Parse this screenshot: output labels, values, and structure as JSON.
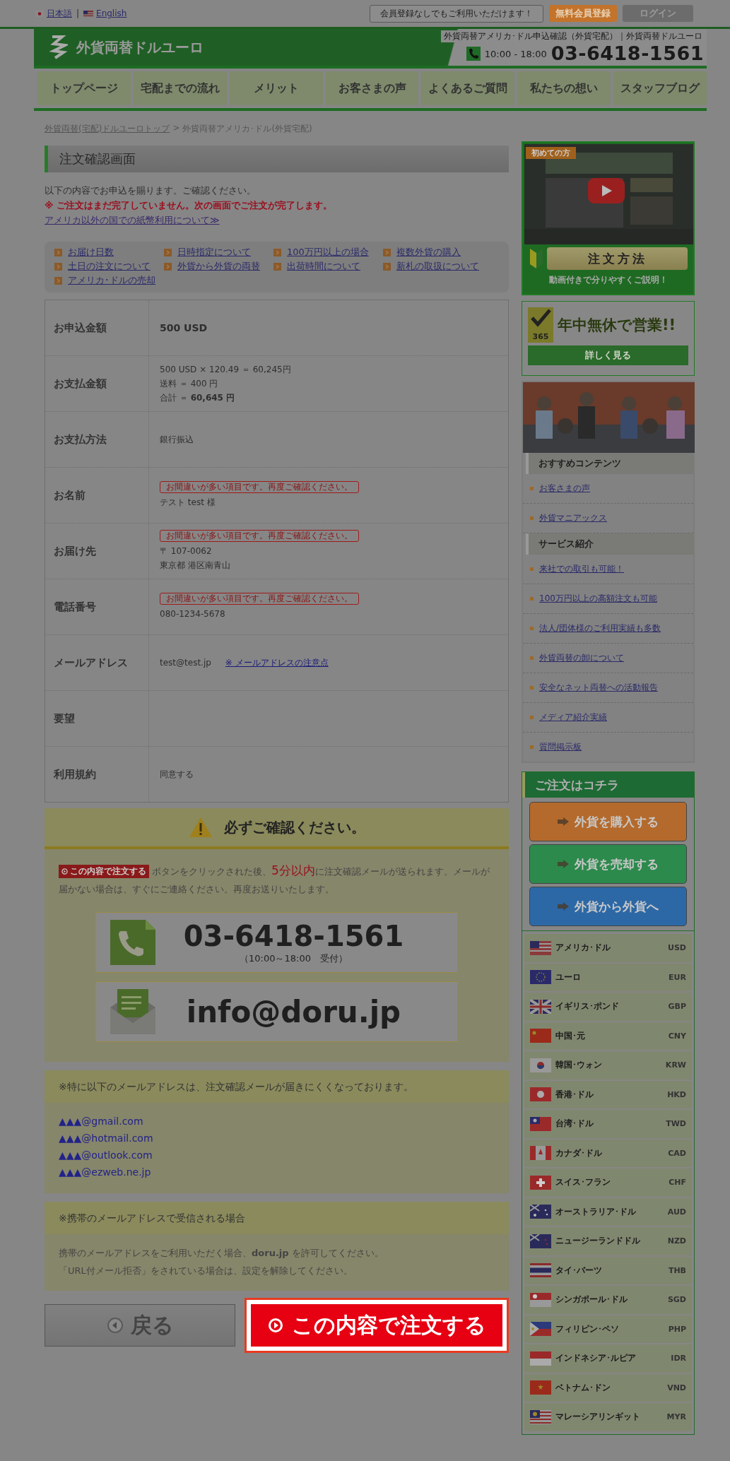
{
  "top_bar": {
    "languages": [
      "日本語",
      "English"
    ],
    "separator": "|",
    "notice": "会員登録なしでもご利用いただけます！",
    "register_button": "無料会員登録",
    "login_button": "ログイン"
  },
  "header": {
    "site_name": "外貨両替ドルユーロ",
    "tagline": "外貨両替アメリカ･ドル申込確認（外貨宅配）｜外貨両替ドルユーロ",
    "hours": "10:00 - 18:00",
    "phone": "03-6418-1561"
  },
  "nav": [
    "トップページ",
    "宅配までの流れ",
    "メリット",
    "お客さまの声",
    "よくあるご質問",
    "私たちの想い",
    "スタッフブログ"
  ],
  "breadcrumb": {
    "link": "外貨両替(宅配)ドルユーロトップ",
    "separator": ">",
    "current": "外貨両替アメリカ･ドル(外貨宅配)"
  },
  "page_title": "注文確認画面",
  "intro": {
    "text": "以下の内容でお申込を賜ります。ご確認ください。",
    "warning": "※ ご注文はまだ完了していません。次の画面でご注文が完了します。",
    "link": "アメリカ以外の国での紙幣利用について≫"
  },
  "faq_links": [
    "お届け日数",
    "日時指定について",
    "100万円以上の場合",
    "複数外貨の購入",
    "土日の注文について",
    "外貨から外貨の両替",
    "出荷時間について",
    "新札の取扱について",
    "アメリカ･ドルの売却"
  ],
  "order_table": [
    {
      "label": "お申込金額",
      "kind": "amount",
      "lines": [
        "500 USD"
      ]
    },
    {
      "label": "お支払金額",
      "kind": "plain",
      "lines": [
        "500 USD × 120.49 ＝ 60,245円",
        "送料 ＝ 400 円",
        "合計 ＝ **60,645 円**"
      ]
    },
    {
      "label": "お支払方法",
      "kind": "plain",
      "lines": [
        "銀行振込"
      ]
    },
    {
      "label": "お名前",
      "kind": "plain",
      "warning": "お間違いが多い項目です。再度ご確認ください。",
      "lines": [
        "テスト test 様"
      ]
    },
    {
      "label": "お届け先",
      "kind": "plain",
      "warning": "お間違いが多い項目です。再度ご確認ください。",
      "lines": [
        "〒 107-0062",
        "東京都 港区南青山"
      ]
    },
    {
      "label": "電話番号",
      "kind": "plain",
      "warning": "お間違いが多い項目です。再度ご確認ください。",
      "lines": [
        "080-1234-5678"
      ]
    },
    {
      "label": "メールアドレス",
      "kind": "plain",
      "lines": [
        "test@test.jp"
      ],
      "link": "※ メールアドレスの注意点"
    },
    {
      "label": "要望",
      "kind": "plain"
    },
    {
      "label": "利用規約",
      "kind": "plain",
      "lines": [
        "同意する"
      ]
    }
  ],
  "notice": {
    "heading": "必ずご確認ください。",
    "badge": "この内容で注文する",
    "text_before": "ボタンをクリックされた後、",
    "highlight": "5分以内",
    "text_after": "に注文確認メールが送られます。メールが届かない場合は、すぐにご連絡ください。再度お送りいたします。",
    "phone": "03-6418-1561",
    "phone_hours": "（10:00～18:00　受付）",
    "email": "info@doru.jp"
  },
  "hard_domains": {
    "heading": "※特に以下のメールアドレスは、注文確認メールが届きにくくなっております。",
    "addresses": [
      "▲▲▲@gmail.com",
      "▲▲▲@hotmail.com",
      "▲▲▲@outlook.com",
      "▲▲▲@ezweb.ne.jp"
    ]
  },
  "mobile": {
    "heading": "※携帯のメールアドレスで受信される場合",
    "lines": [
      "携帯のメールアドレスをご利用いただく場合、**doru.jp** を許可してください。",
      "「URL付メール拒否」をされている場合は、設定を解除してください。"
    ]
  },
  "actions": {
    "back": "戻る",
    "submit": "この内容で注文する"
  },
  "sidebar": {
    "video_banner": {
      "ribbon": "初めての方",
      "button": "注文方法",
      "caption": "動画付きで分りやすくご説明！"
    },
    "open_banner": {
      "badge": "365",
      "headline": "**年中無休**で営業!!",
      "button": "詳しく見る"
    },
    "sections": [
      {
        "heading": "おすすめコンテンツ",
        "items": [
          "お客さまの声",
          "外貨マニアックス"
        ]
      },
      {
        "heading": "サービス紹介",
        "items": [
          "来社での取引も可能！",
          "100万円以上の高額注文も可能",
          "法人/団体様のご利用実績も多数",
          "外貨両替の卸について",
          "安全なネット両替への活動報告",
          "メディア紹介実績",
          "質問掲示板"
        ]
      }
    ],
    "order": {
      "heading": "ご注文はコチラ",
      "buttons": [
        {
          "label": "**外貨**を**購入**する",
          "color": "#b46a2c"
        },
        {
          "label": "**外貨**を**売却**する",
          "color": "#2c8a4c"
        },
        {
          "label": "**外貨**から**外貨**へ",
          "color": "#2c68a6"
        }
      ]
    },
    "currencies": [
      {
        "name": "アメリカ･ドル",
        "code": "USD"
      },
      {
        "name": "ユーロ",
        "code": "EUR"
      },
      {
        "name": "イギリス･ポンド",
        "code": "GBP"
      },
      {
        "name": "中国･元",
        "code": "CNY"
      },
      {
        "name": "韓国･ウォン",
        "code": "KRW"
      },
      {
        "name": "香港･ドル",
        "code": "HKD"
      },
      {
        "name": "台湾･ドル",
        "code": "TWD"
      },
      {
        "name": "カナダ･ドル",
        "code": "CAD"
      },
      {
        "name": "スイス･フラン",
        "code": "CHF"
      },
      {
        "name": "オーストラリア･ドル",
        "code": "AUD"
      },
      {
        "name": "ニュージーランドドル",
        "code": "NZD"
      },
      {
        "name": "タイ･バーツ",
        "code": "THB"
      },
      {
        "name": "シンガポール･ドル",
        "code": "SGD"
      },
      {
        "name": "フィリピン･ペソ",
        "code": "PHP"
      },
      {
        "name": "インドネシア･ルピア",
        "code": "IDR"
      },
      {
        "name": "ベトナム･ドン",
        "code": "VND"
      },
      {
        "name": "マレーシアリンギット",
        "code": "MYR"
      }
    ]
  }
}
